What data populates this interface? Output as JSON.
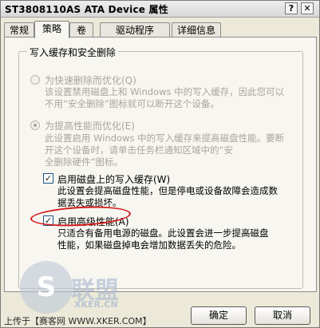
{
  "window": {
    "title": "ST3808110AS ATA Device 属性",
    "help_label": "?",
    "close_label": "✕"
  },
  "tabs": [
    {
      "label": "常规"
    },
    {
      "label": "策略"
    },
    {
      "label": "卷"
    },
    {
      "label": "驱动程序"
    },
    {
      "label": "详细信息"
    }
  ],
  "active_tab": "策略",
  "group": {
    "title": "写入缓存和安全删除",
    "quick_remove": {
      "label": "为快速删除而优化(Q)",
      "desc_line1": "该设置禁用磁盘上和 Windows 中的写入缓存，因此您可以",
      "desc_line2": "不用“安全删除”图标就可以断开这个设备。",
      "checked": false
    },
    "performance": {
      "label": "为提高性能而优化(E)",
      "desc_line1": "此设置启用 Windows 中的写入缓存来提高磁盘性能。要断",
      "desc_line2": "开这个设备时，请单击任务栏通知区域中的“安",
      "desc_line3": "全删除硬件”图标。",
      "checked": true
    },
    "write_cache": {
      "label": "启用磁盘上的写入缓存(W)",
      "desc_line1": "此设置会提高磁盘性能，但是停电或设备故障会造成数",
      "desc_line2": "据丢失或损坏。",
      "checked": true,
      "mark": "✓"
    },
    "advanced": {
      "label": "启用高级性能(A)",
      "desc_line1": "只适合有备用电源的磁盘。此设置会进一步提高磁盘",
      "desc_line2": "性能，如果磁盘掉电会增加数据丢失的危险。",
      "checked": true,
      "mark": "✓"
    }
  },
  "buttons": {
    "ok": "确定",
    "cancel": "取消"
  },
  "watermark": {
    "logo_letter": "S",
    "brand": "联盟",
    "url": "XKER.CN",
    "upload_text": "上传于【赛客网 WWW.XKER.COM】"
  },
  "colors": {
    "highlight_circle": "#d41a1a",
    "checkbox_border": "#1c5180"
  }
}
